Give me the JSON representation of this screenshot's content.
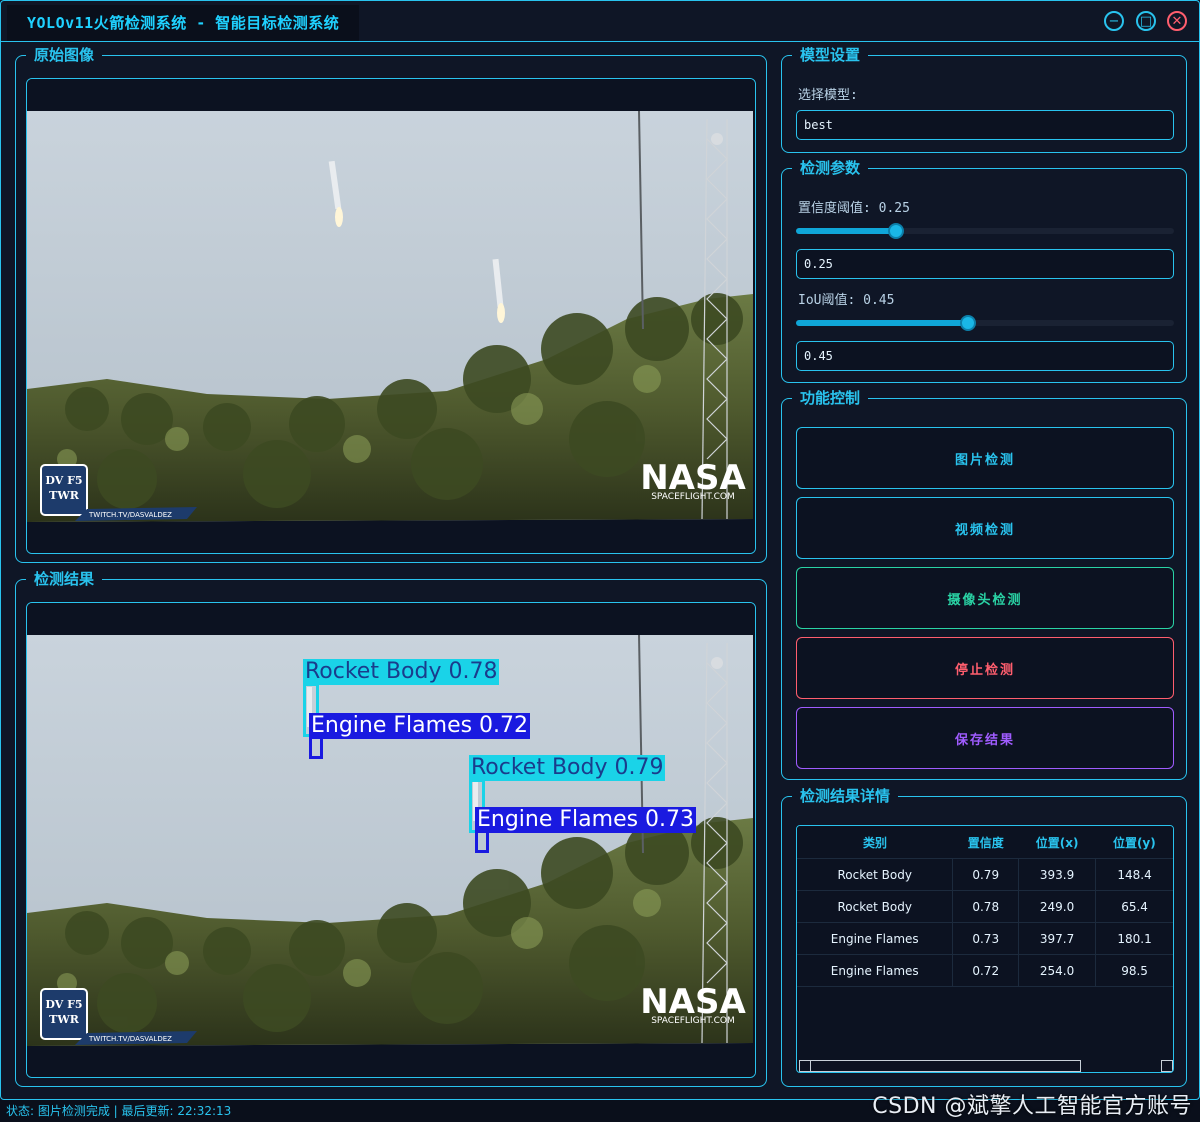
{
  "window": {
    "title": "YOLOv11火箭检测系统 - 智能目标检测系统",
    "controls": {
      "minimize": "−",
      "maximize": "□",
      "close": "✕"
    }
  },
  "panels": {
    "original_title": "原始图像",
    "result_title": "检测结果"
  },
  "image": {
    "watermark_brand": "NASA",
    "watermark_sub": "SPACEFLIGHT.COM",
    "badge_line1": "DV F5",
    "badge_line2": "TWR",
    "badge_url": "TWITCH.TV/DASVALDEZ"
  },
  "detections": [
    {
      "label": "Rocket Body 0.78",
      "class": "Rocket Body"
    },
    {
      "label": "Engine Flames 0.72",
      "class": "Engine Flames"
    },
    {
      "label": "Rocket Body 0.79",
      "class": "Rocket Body"
    },
    {
      "label": "Engine Flames 0.73",
      "class": "Engine Flames"
    }
  ],
  "model_settings": {
    "title": "模型设置",
    "select_label": "选择模型:",
    "selected_model": "best"
  },
  "params": {
    "title": "检测参数",
    "conf_label": "置信度阈值: 0.25",
    "conf_value": "0.25",
    "conf_level": 0.25,
    "iou_label": "IoU阈值: 0.45",
    "iou_value": "0.45",
    "iou_level": 0.45
  },
  "controls": {
    "title": "功能控制",
    "image_detect": "图片检测",
    "video_detect": "视频检测",
    "camera_detect": "摄像头检测",
    "stop_detect": "停止检测",
    "save_results": "保存结果",
    "colors": {
      "image": "#29c3ee",
      "video": "#29c3ee",
      "camera": "#2ad3a5",
      "stop": "#ff5e6e",
      "save": "#a05cff"
    }
  },
  "details": {
    "title": "检测结果详情",
    "headers": [
      "类别",
      "置信度",
      "位置(x)",
      "位置(y)"
    ],
    "rows": [
      [
        "Rocket Body",
        "0.79",
        "393.9",
        "148.4"
      ],
      [
        "Rocket Body",
        "0.78",
        "249.0",
        "65.4"
      ],
      [
        "Engine Flames",
        "0.73",
        "397.7",
        "180.1"
      ],
      [
        "Engine Flames",
        "0.72",
        "254.0",
        "98.5"
      ]
    ]
  },
  "status": {
    "text": "状态: 图片检测完成 | 最后更新: 22:32:13"
  },
  "overlay": {
    "watermark": "CSDN @斌擎人工智能官方账号"
  }
}
